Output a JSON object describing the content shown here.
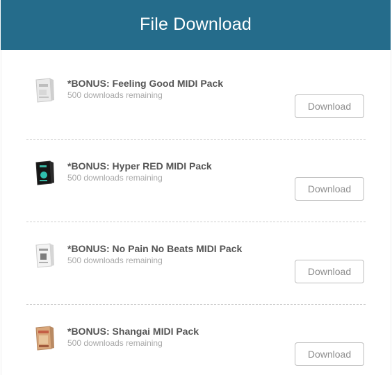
{
  "header": {
    "title": "File Download"
  },
  "files": [
    {
      "title": "*BONUS: Feeling Good MIDI Pack",
      "remaining": "500 downloads remaining",
      "button": "Download",
      "thumb": "feeling-good-box"
    },
    {
      "title": "*BONUS: Hyper RED MIDI Pack",
      "remaining": "500 downloads remaining",
      "button": "Download",
      "thumb": "hyper-red-box"
    },
    {
      "title": "*BONUS: No Pain No Beats MIDI Pack",
      "remaining": "500 downloads remaining",
      "button": "Download",
      "thumb": "no-pain-no-beats-box"
    },
    {
      "title": "*BONUS: Shangai MIDI Pack",
      "remaining": "500 downloads remaining",
      "button": "Download",
      "thumb": "shangai-box"
    }
  ],
  "colors": {
    "header_bg": "#256c8b",
    "header_text": "#ffffff",
    "title_text": "#555555",
    "sub_text": "#a9a9a9"
  }
}
